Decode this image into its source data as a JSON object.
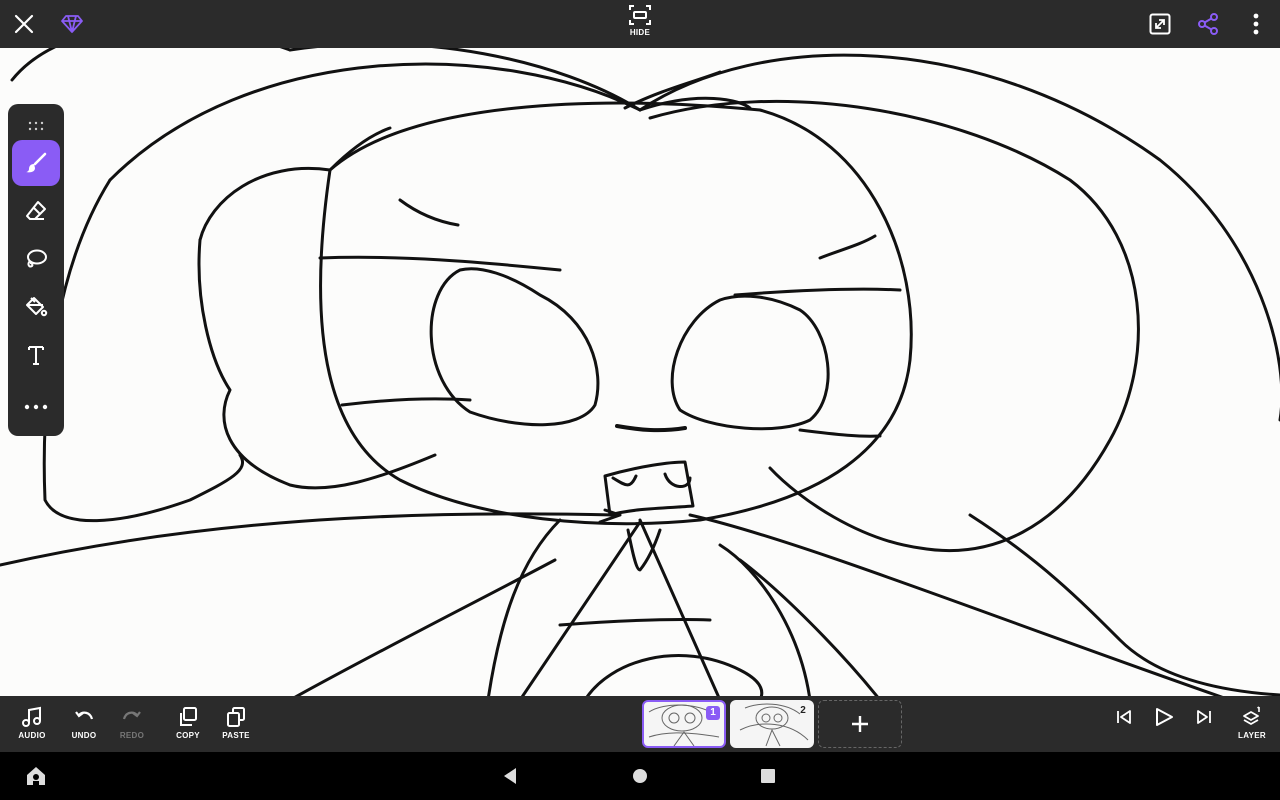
{
  "topbar": {
    "close_icon": "close-icon",
    "premium_icon": "diamond-icon",
    "hide_label": "HIDE",
    "fullscreen_icon": "fullscreen-icon",
    "share_icon": "share-icon",
    "more_icon": "more-vertical-icon",
    "accent_color": "#8a5cf5"
  },
  "tools": [
    {
      "name": "brush",
      "icon": "brush-icon",
      "active": true
    },
    {
      "name": "eraser",
      "icon": "eraser-icon",
      "active": false
    },
    {
      "name": "lasso",
      "icon": "lasso-icon",
      "active": false
    },
    {
      "name": "fill",
      "icon": "paint-bucket-icon",
      "active": false
    },
    {
      "name": "text",
      "icon": "text-icon",
      "active": false
    },
    {
      "name": "more",
      "icon": "more-horizontal-icon",
      "active": false
    }
  ],
  "bottombar": {
    "audio_label": "AUDIO",
    "undo_label": "UNDO",
    "redo_label": "REDO",
    "copy_label": "COPY",
    "paste_label": "PASTE",
    "layer_label": "LAYER",
    "frames": [
      {
        "number": "1",
        "active": true
      },
      {
        "number": "2",
        "active": false
      }
    ],
    "add_frame_icon": "plus-icon"
  },
  "navbar": {
    "home_icon": "home-app-icon",
    "back_icon": "back-icon",
    "home_circle_icon": "home-icon",
    "recents_icon": "recents-icon"
  }
}
